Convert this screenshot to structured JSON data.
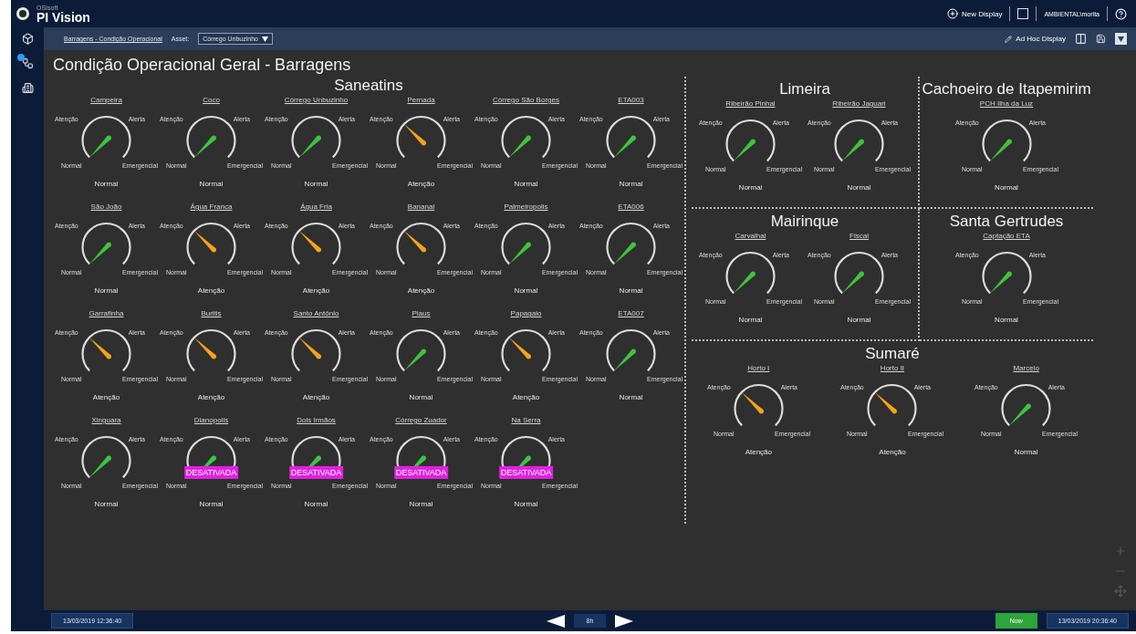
{
  "header": {
    "brand_small": "OSIsoft",
    "app_name": "PI Vision",
    "new_display": "New Display",
    "user": "AMBIENTAL\\morita"
  },
  "toolbar": {
    "breadcrumb": "Barragens - Condição Operacional",
    "asset_label": "Asset:",
    "asset_value": "Córrego Unbuzinho",
    "ad_hoc": "Ad Hoc Display"
  },
  "page_title": "Condição Operacional Geral - Barragens",
  "main_section": {
    "title": "Saneatins",
    "gauges": [
      {
        "name": "Campeira",
        "value": "Normal",
        "kind": "normal",
        "scale": [
          "Atenção",
          "Alerta",
          "Normal",
          "Emergencial"
        ]
      },
      {
        "name": "Coco",
        "value": "Normal",
        "kind": "normal",
        "scale": [
          "Atenção",
          "Alerta",
          "Normal",
          "Emergencial"
        ]
      },
      {
        "name": "Córrego Unbuzinho",
        "value": "Normal",
        "kind": "normal",
        "scale": [
          "Atenção",
          "Alerta",
          "Normal",
          "Emergencial"
        ]
      },
      {
        "name": "Pernada",
        "value": "Atenção",
        "kind": "attention",
        "scale": [
          "Atenção",
          "Alerta",
          "Normal",
          "Emergencial"
        ]
      },
      {
        "name": "Córrego São Borges",
        "value": "Normal",
        "kind": "normal",
        "scale": [
          "Atenção",
          "Alerta",
          "Normal",
          "Emergencial"
        ]
      },
      {
        "name": "ETA003",
        "value": "Normal",
        "kind": "normal",
        "scale": [
          "Atenção",
          "Alerta",
          "Normal",
          "Emergencial"
        ]
      },
      {
        "name": "São João",
        "value": "Normal",
        "kind": "normal",
        "scale": [
          "Atenção",
          "Alerta",
          "Normal",
          "Emergencial"
        ]
      },
      {
        "name": "Água Franca",
        "value": "Atenção",
        "kind": "attention",
        "scale": [
          "Atenção",
          "Alerta",
          "Normal",
          "Emergencial"
        ]
      },
      {
        "name": "Água Fria",
        "value": "Atenção",
        "kind": "attention",
        "scale": [
          "Atenção",
          "Alerta",
          "Normal",
          "Emergencial"
        ]
      },
      {
        "name": "Bananal",
        "value": "Atenção",
        "kind": "attention",
        "scale": [
          "Atenção",
          "Alerta",
          "Normal",
          "Emergencial"
        ]
      },
      {
        "name": "Palmeiropolis",
        "value": "Normal",
        "kind": "normal",
        "scale": [
          "Atenção",
          "Alerta",
          "Normal",
          "Emergencial"
        ]
      },
      {
        "name": "ETA006",
        "value": "Normal",
        "kind": "normal",
        "scale": [
          "Atenção",
          "Alerta",
          "Normal",
          "Emergencial"
        ]
      },
      {
        "name": "Garrafinha",
        "value": "Atenção",
        "kind": "attention",
        "scale": [
          "Atenção",
          "Alerta",
          "Normal",
          "Emergencial"
        ]
      },
      {
        "name": "Buritis",
        "value": "Atenção",
        "kind": "attention",
        "scale": [
          "Atenção",
          "Alerta",
          "Normal",
          "Emergencial"
        ]
      },
      {
        "name": "Santo Antônio",
        "value": "Atenção",
        "kind": "attention",
        "scale": [
          "Atenção",
          "Alerta",
          "Normal",
          "Emergencial"
        ]
      },
      {
        "name": "Piaus",
        "value": "Normal",
        "kind": "normal",
        "scale": [
          "Atenção",
          "Alerta",
          "Normal",
          "Emergencial"
        ]
      },
      {
        "name": "Papagaio",
        "value": "Atenção",
        "kind": "attention",
        "scale": [
          "Atenção",
          "Alerta",
          "Normal",
          "Emergencial"
        ]
      },
      {
        "name": "ETA007",
        "value": "Normal",
        "kind": "normal",
        "scale": [
          "Atenção",
          "Alerta",
          "Normal",
          "Emergencial"
        ]
      },
      {
        "name": "Xinguara",
        "value": "Normal",
        "kind": "normal",
        "scale": [
          "Atenção",
          "Alerta",
          "Normal",
          "Emergencial"
        ]
      },
      {
        "name": "Dianopolis",
        "value": "Normal",
        "kind": "normal",
        "badge": "DESATIVADA",
        "scale": [
          "Atenção",
          "Alerta",
          "Normal",
          "Emergencial"
        ]
      },
      {
        "name": "Dois Irmãos",
        "value": "Normal",
        "kind": "normal",
        "badge": "DESATIVADA",
        "scale": [
          "Atenção",
          "Alerta",
          "Normal",
          "Emergencial"
        ]
      },
      {
        "name": "Córrego Zuador",
        "value": "Normal",
        "kind": "normal",
        "badge": "DESATIVADA",
        "scale": [
          "Atenção",
          "Alerta",
          "Normal",
          "Emergencial"
        ]
      },
      {
        "name": "Na Serra",
        "value": "Normal",
        "kind": "normal",
        "badge": "DESATIVADA",
        "scale": [
          "Atenção",
          "Alerta",
          "Normal",
          "Emergencial"
        ]
      }
    ]
  },
  "side_sections": [
    {
      "title": "Limeira",
      "gauges": [
        {
          "name": "Ribeirão Pinhal",
          "value": "Normal",
          "kind": "normal",
          "scale": [
            "Atenção",
            "Alerta",
            "Normal",
            "Emergencial"
          ]
        },
        {
          "name": "Ribeirão Jaguari",
          "value": "Normal",
          "kind": "normal",
          "scale": [
            "Atenção",
            "Alerta",
            "Normal",
            "Emergencial"
          ]
        }
      ]
    },
    {
      "title": "Cachoeiro de Itapemirim",
      "gauges": [
        {
          "name": "PCH Ilha da Luz",
          "value": "Normal",
          "kind": "normal",
          "scale": [
            "Atenção",
            "Alerta",
            "Normal",
            "Emergencial"
          ]
        }
      ]
    },
    {
      "title": "Mairinque",
      "gauges": [
        {
          "name": "Carvalhal",
          "value": "Normal",
          "kind": "normal",
          "scale": [
            "Atenção",
            "Alerta",
            "Normal",
            "Emergencial"
          ]
        },
        {
          "name": "Fiscal",
          "value": "Normal",
          "kind": "normal",
          "scale": [
            "Atenção",
            "Alerta",
            "Normal",
            "Emergencial"
          ]
        }
      ]
    },
    {
      "title": "Santa Gertrudes",
      "gauges": [
        {
          "name": "Captação ETA",
          "value": "Normal",
          "kind": "normal",
          "scale": [
            "Atenção",
            "Alerta",
            "Normal",
            "Emergencial"
          ]
        }
      ]
    },
    {
      "title": "Sumaré",
      "gauges": [
        {
          "name": "Horto I",
          "value": "Atenção",
          "kind": "attention",
          "scale": [
            "Atenção",
            "Alerta",
            "Normal",
            "Emergencial"
          ]
        },
        {
          "name": "Horto II",
          "value": "Atenção",
          "kind": "attention",
          "scale": [
            "Atenção",
            "Alerta",
            "Normal",
            "Emergencial"
          ]
        },
        {
          "name": "Marcelo",
          "value": "Normal",
          "kind": "normal",
          "scale": [
            "Atenção",
            "Alerta",
            "Normal",
            "Emergencial"
          ]
        }
      ]
    }
  ],
  "footer": {
    "start": "13/03/2019 12:36:40",
    "duration": "8h",
    "now": "Now",
    "end": "13/03/2019 20:36:40"
  }
}
